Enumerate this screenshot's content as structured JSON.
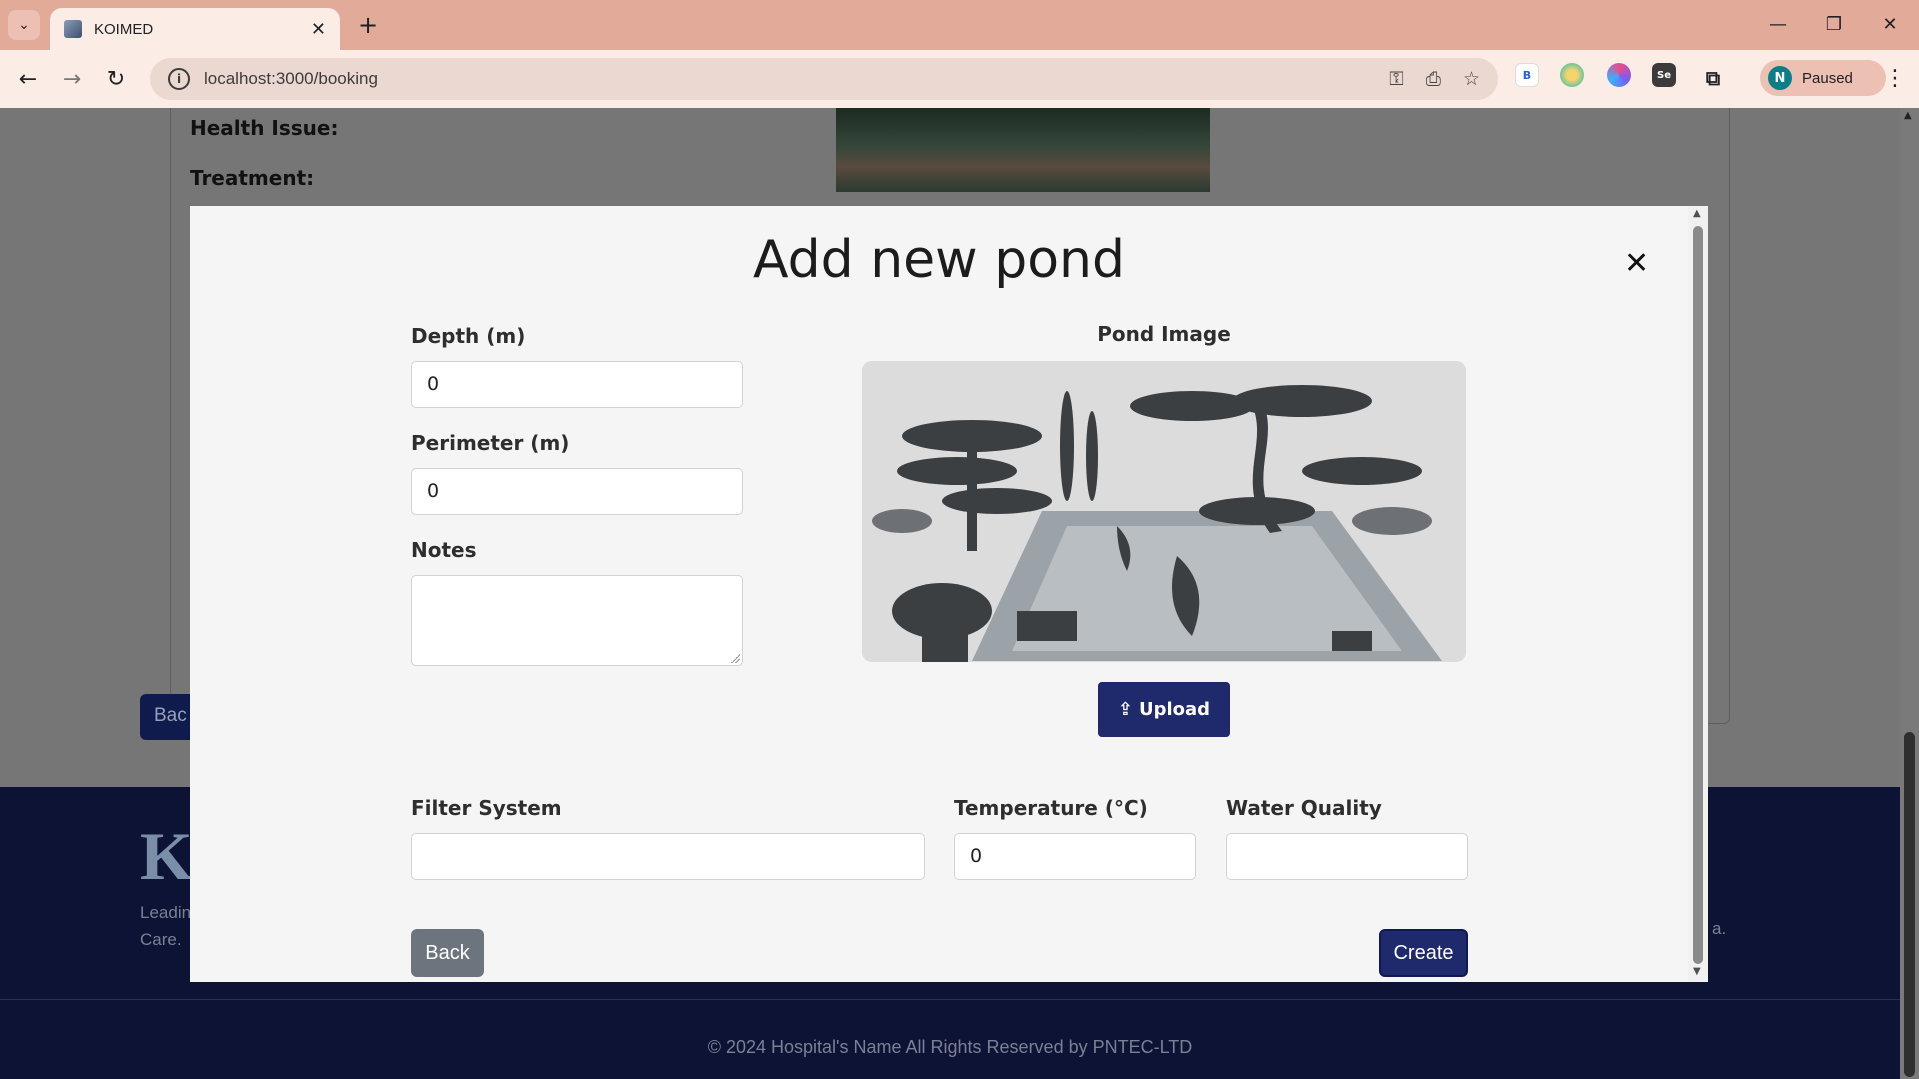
{
  "browser": {
    "tab_title": "KOIMED",
    "url": "localhost:3000/booking",
    "profile_initial": "N",
    "profile_status": "Paused",
    "extensions": [
      "B",
      "",
      "",
      "Se",
      ""
    ]
  },
  "background": {
    "health_issue_label": "Health Issue:",
    "treatment_label": "Treatment:",
    "back_label": "Bac",
    "footer_logo": "K",
    "footer_tagline_1": "Leadin",
    "footer_tagline_2": "Care.",
    "footer_end": "a.",
    "copyright": "© 2024 Hospital's Name All Rights Reserved by PNTEC-LTD"
  },
  "modal": {
    "title": "Add new pond",
    "close_symbol": "✕",
    "depth_label": "Depth (m)",
    "depth_value": "0",
    "perimeter_label": "Perimeter (m)",
    "perimeter_value": "0",
    "notes_label": "Notes",
    "notes_value": "",
    "pond_image_label": "Pond Image",
    "upload_label": "Upload",
    "filter_label": "Filter System",
    "filter_value": "",
    "temperature_label": "Temperature (°C)",
    "temperature_value": "0",
    "water_quality_label": "Water Quality",
    "water_quality_value": "",
    "back_label": "Back",
    "create_label": "Create"
  },
  "colors": {
    "primary": "#1e2a6b",
    "secondary": "#6c757d",
    "tab_strip": "#e2aa99",
    "footer": "#0d1335"
  }
}
